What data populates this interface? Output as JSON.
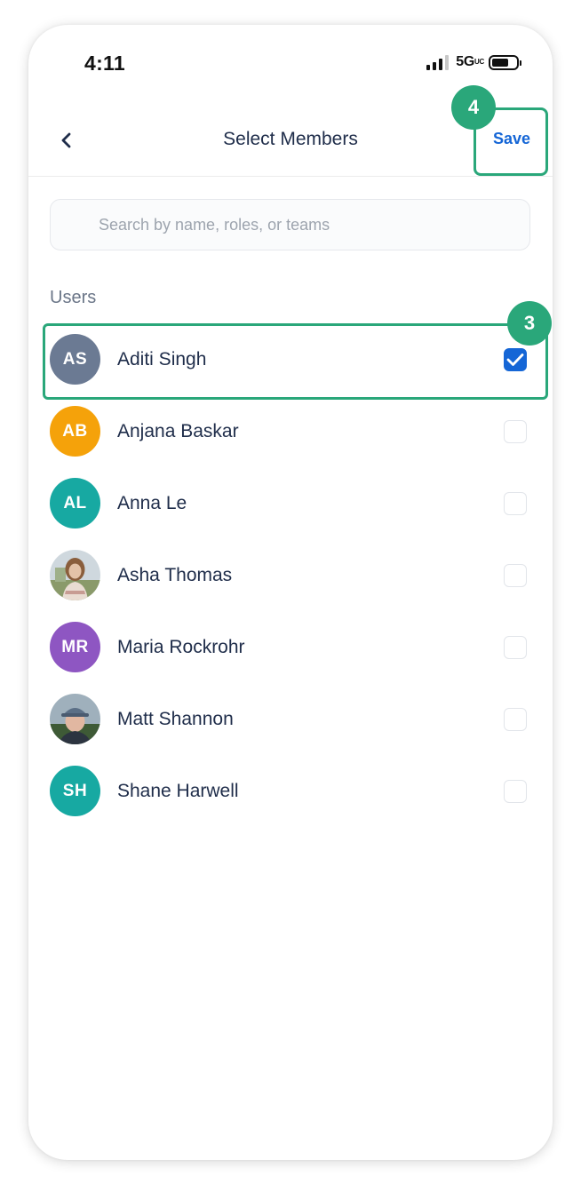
{
  "status_bar": {
    "time": "4:11",
    "network": "5G",
    "network_suffix": "UC"
  },
  "nav": {
    "title": "Select Members",
    "save_label": "Save"
  },
  "badges": {
    "save_step": "4",
    "row_step": "3"
  },
  "search": {
    "placeholder": "Search by name, roles, or teams",
    "value": ""
  },
  "section_label": "Users",
  "users": [
    {
      "initials": "AS",
      "name": "Aditi Singh",
      "color": "#6b7a93",
      "checked": true,
      "photo": false
    },
    {
      "initials": "AB",
      "name": "Anjana Baskar",
      "color": "#f5a20a",
      "checked": false,
      "photo": false
    },
    {
      "initials": "AL",
      "name": "Anna Le",
      "color": "#17a9a2",
      "checked": false,
      "photo": false
    },
    {
      "initials": "",
      "name": "Asha Thomas",
      "color": "#b89b7e",
      "checked": false,
      "photo": true
    },
    {
      "initials": "MR",
      "name": "Maria Rockrohr",
      "color": "#8e56c2",
      "checked": false,
      "photo": false
    },
    {
      "initials": "",
      "name": "Matt Shannon",
      "color": "#56687a",
      "checked": false,
      "photo": true
    },
    {
      "initials": "SH",
      "name": "Shane Harwell",
      "color": "#17a9a2",
      "checked": false,
      "photo": false
    }
  ],
  "colors": {
    "accent": "#1566d6",
    "highlight": "#2aa77a",
    "text": "#1f2d4a"
  }
}
